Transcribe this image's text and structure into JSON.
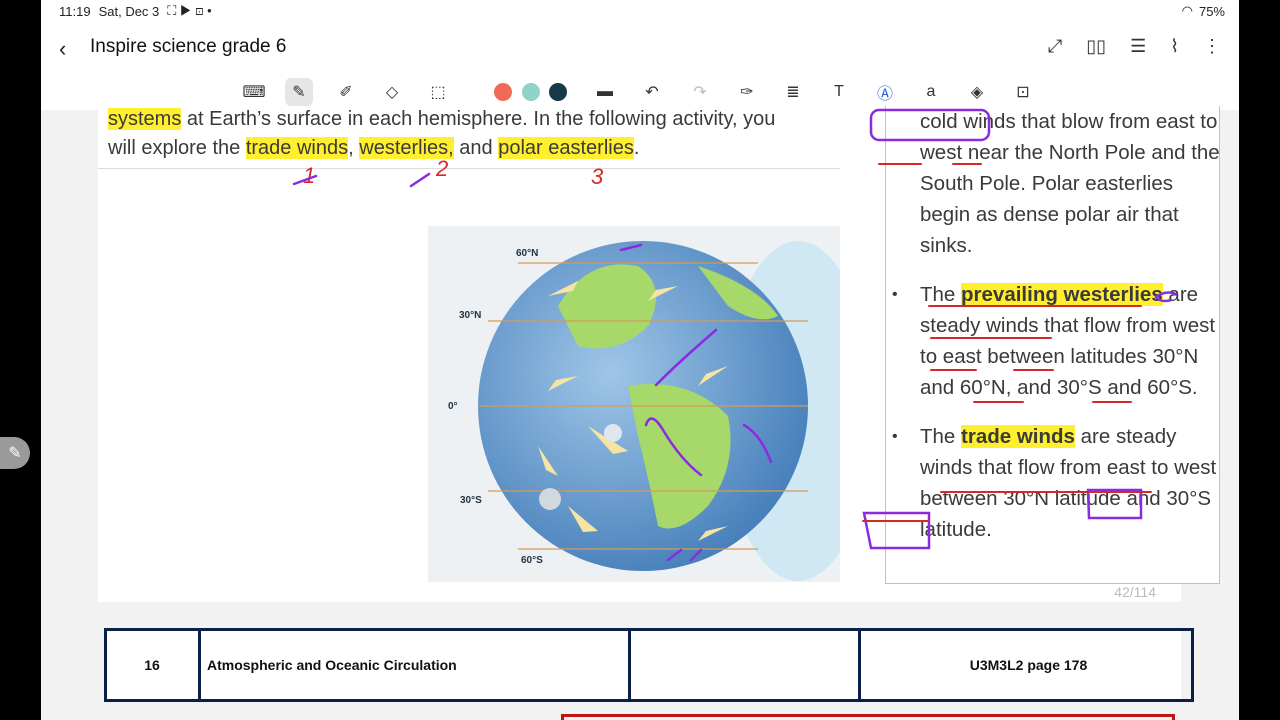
{
  "status": {
    "time": "11:19",
    "date": "Sat, Dec 3",
    "battery": "75%"
  },
  "app": {
    "title": "Inspire science grade 6"
  },
  "toolbar": {
    "tools": [
      "keyboard-icon",
      "pen-icon",
      "highlighter-icon",
      "eraser-icon",
      "lasso-icon"
    ],
    "colors": [
      "#f06b57",
      "#8fd3c9",
      "#173a4a"
    ]
  },
  "main": {
    "line1_hl": "systems",
    "line1_rest": " at Earth’s surface in each hemisphere. In the following activity, you",
    "line2_a": "will explore the ",
    "term1": "trade winds",
    "sep1": ", ",
    "term2": "westerlies,",
    "sep2": " and ",
    "term3": "polar easterlies",
    "end": "."
  },
  "figure": {
    "lat_60n": "60°N",
    "lat_30n": "30°N",
    "lat_0": "0°",
    "lat_30s": "30°S",
    "lat_60s": "60°S"
  },
  "sidebar": {
    "p1_a": "cold winds",
    "p1_b": " that blow from east to west near the North Pole and the South Pole. Polar easterlies begin as dense polar air that sinks.",
    "b2_a": "The ",
    "b2_term": "prevailing westerlies",
    "b2_rest": " are steady winds that flow from west to east between latitudes 30°N and 60°N, and 30°S and 60°S.",
    "b3_a": "The ",
    "b3_term": "trade winds",
    "b3_rest": " are steady winds that flow from east to west between 30°N latitude and 30°S latitude."
  },
  "page_indicator": "42/114",
  "footer": {
    "num": "16",
    "title": "Atmospheric and Oceanic Circulation",
    "ref": "U3M3L2  page 178"
  },
  "annotations": {
    "n1": "1",
    "n2": "2",
    "n3": "3"
  }
}
